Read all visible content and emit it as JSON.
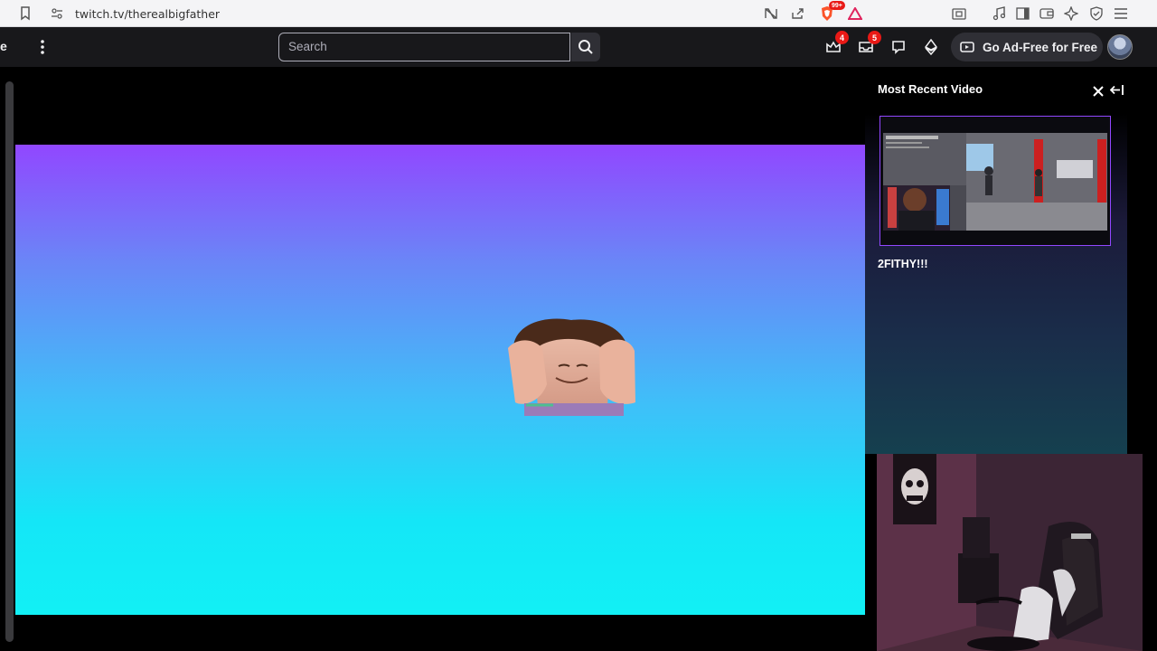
{
  "browser": {
    "url": "twitch.tv/therealbigfather",
    "extension_badge": "99+"
  },
  "nav": {
    "edge_text": "e",
    "search_placeholder": "Search",
    "notifications": [
      {
        "name": "prime-loot",
        "count": "4"
      },
      {
        "name": "inbox",
        "count": "5"
      }
    ],
    "ad_free_label": "Go Ad-Free for Free"
  },
  "panel": {
    "title": "Most Recent Video",
    "video_title": "2FITHY!!!"
  },
  "colors": {
    "twitch_purple": "#9147ff",
    "stage_bottom": "#12f0f5",
    "badge_red": "#e91916"
  }
}
